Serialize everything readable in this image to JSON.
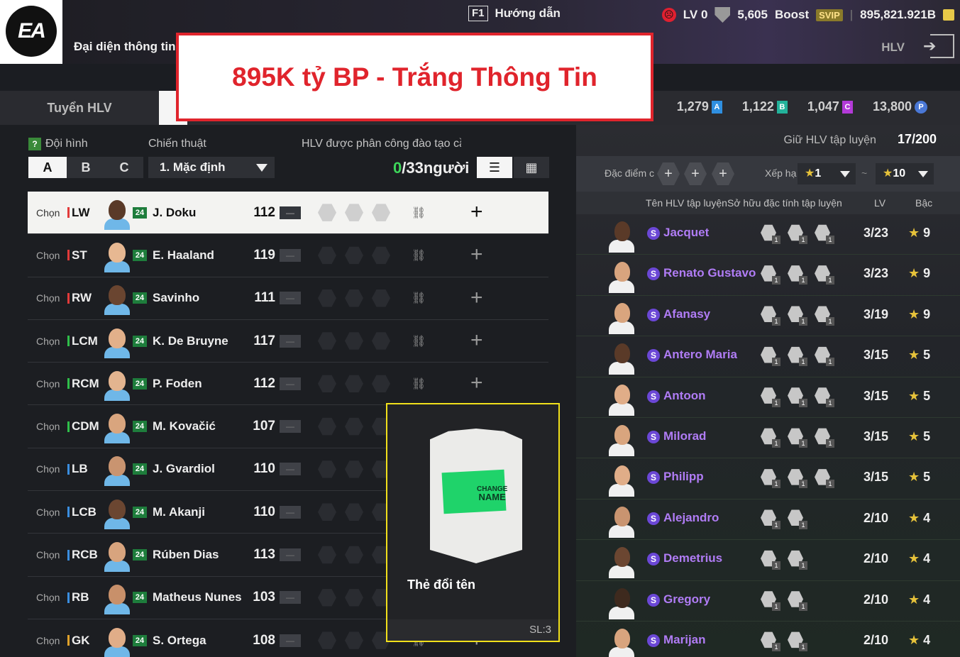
{
  "header": {
    "logo_text": "EA",
    "subtitle": "Đại diện thông tin độ",
    "help_key": "F1",
    "help_label": "Hướng dẫn",
    "lv": "LV 0",
    "rank_points": "5,605",
    "boost_label": "Boost",
    "svip_label": "SVIP",
    "bp": "895,821.921B",
    "hlv_label": "HLV"
  },
  "banner": {
    "text": "895K tỷ BP - Trắng Thông Tin"
  },
  "tabs": {
    "hlv_tab": "Tuyển HLV"
  },
  "currencies": [
    {
      "value": "1,279",
      "badge": "A",
      "color": "#2f8fe0"
    },
    {
      "value": "1,122",
      "badge": "B",
      "color": "#23b39b"
    },
    {
      "value": "1,047",
      "badge": "C",
      "color": "#b33ad8"
    },
    {
      "value": "13,800",
      "badge": "P",
      "color": "#4a78d6"
    }
  ],
  "left": {
    "formation_label": "Đội hình",
    "tactic_label": "Chiến thuật",
    "assign_label": "HLV được phân công đào tạo cầu th",
    "squads": [
      "A",
      "B",
      "C"
    ],
    "tactic_value": "1. Mặc định",
    "count_assigned": "0",
    "count_total": "/33người",
    "choose_label": "Chọn",
    "players": [
      {
        "pos": "LW",
        "pos_color": "#e23a3a",
        "season": "24",
        "name": "J. Doku",
        "ovr": "112",
        "skin": "#5a3a28",
        "kit": "#6fb7e8"
      },
      {
        "pos": "ST",
        "pos_color": "#e23a3a",
        "season": "24",
        "name": "E. Haaland",
        "ovr": "119",
        "skin": "#e7b892",
        "kit": "#6fb7e8"
      },
      {
        "pos": "RW",
        "pos_color": "#e23a3a",
        "season": "24",
        "name": "Savinho",
        "ovr": "111",
        "skin": "#6a4530",
        "kit": "#6fb7e8"
      },
      {
        "pos": "LCM",
        "pos_color": "#2fbf4a",
        "season": "24",
        "name": "K. De Bruyne",
        "ovr": "117",
        "skin": "#e2b08a",
        "kit": "#6fb7e8"
      },
      {
        "pos": "RCM",
        "pos_color": "#2fbf4a",
        "season": "24",
        "name": "P. Foden",
        "ovr": "112",
        "skin": "#e3b48f",
        "kit": "#6fb7e8"
      },
      {
        "pos": "CDM",
        "pos_color": "#2fbf4a",
        "season": "24",
        "name": "M. Kovačić",
        "ovr": "107",
        "skin": "#d9a57e",
        "kit": "#6fb7e8"
      },
      {
        "pos": "LB",
        "pos_color": "#3a8ee0",
        "season": "24",
        "name": "J. Gvardiol",
        "ovr": "110",
        "skin": "#c99470",
        "kit": "#6fb7e8"
      },
      {
        "pos": "LCB",
        "pos_color": "#3a8ee0",
        "season": "24",
        "name": "M. Akanji",
        "ovr": "110",
        "skin": "#6b4631",
        "kit": "#6fb7e8"
      },
      {
        "pos": "RCB",
        "pos_color": "#3a8ee0",
        "season": "24",
        "name": "Rúben Dias",
        "ovr": "113",
        "skin": "#d8a47e",
        "kit": "#6fb7e8"
      },
      {
        "pos": "RB",
        "pos_color": "#3a8ee0",
        "season": "24",
        "name": "Matheus Nunes",
        "ovr": "103",
        "skin": "#c8906a",
        "kit": "#6fb7e8"
      },
      {
        "pos": "GK",
        "pos_color": "#e0a22a",
        "season": "24",
        "name": "S. Ortega",
        "ovr": "108",
        "skin": "#e0ad88",
        "kit": "#6fb7e8"
      }
    ]
  },
  "card_popup": {
    "card_text_line1": "CHANGE",
    "card_text_line2": "NAME",
    "name": "Thẻ đổi tên",
    "quantity": "SL:3"
  },
  "right": {
    "keep_label": "Giữ HLV tập luyện",
    "keep_count": "17/200",
    "trait_filter_label": "Đặc điểm c",
    "rank_filter_label": "Xếp hạ",
    "rank_from": "1",
    "rank_to": "10",
    "col_name": "Tên HLV tập luyện",
    "col_traits": "Sở hữu đặc tính tập luyện",
    "col_lv": "LV",
    "col_rank": "Bậc",
    "coaches": [
      {
        "name": "Jacquet",
        "lv": "3/23",
        "rank": "9",
        "traits": [
          "1",
          "1",
          "1"
        ],
        "skin": "#5a3a28"
      },
      {
        "name": "Renato Gustavo",
        "lv": "3/23",
        "rank": "9",
        "traits": [
          "1",
          "1",
          "1"
        ],
        "skin": "#d8a47e"
      },
      {
        "name": "Afanasy",
        "lv": "3/19",
        "rank": "9",
        "traits": [
          "1",
          "1",
          "1"
        ],
        "skin": "#d9a57e"
      },
      {
        "name": "Antero Maria",
        "lv": "3/15",
        "rank": "5",
        "traits": [
          "1",
          "1",
          "1"
        ],
        "skin": "#5a3a28"
      },
      {
        "name": "Antoon",
        "lv": "3/15",
        "rank": "5",
        "traits": [
          "1",
          "1",
          "1"
        ],
        "skin": "#e0ad88"
      },
      {
        "name": "Milorad",
        "lv": "3/15",
        "rank": "5",
        "traits": [
          "1",
          "1",
          "1"
        ],
        "skin": "#d9a57e"
      },
      {
        "name": "Philipp",
        "lv": "3/15",
        "rank": "5",
        "traits": [
          "1",
          "1",
          "1"
        ],
        "skin": "#e0ad88"
      },
      {
        "name": "Alejandro",
        "lv": "2/10",
        "rank": "4",
        "traits": [
          "1",
          "1"
        ],
        "skin": "#c99470"
      },
      {
        "name": "Demetrius",
        "lv": "2/10",
        "rank": "4",
        "traits": [
          "1",
          "1"
        ],
        "skin": "#6b4631"
      },
      {
        "name": "Gregory",
        "lv": "2/10",
        "rank": "4",
        "traits": [
          "1",
          "1"
        ],
        "skin": "#3e2a1e"
      },
      {
        "name": "Marijan",
        "lv": "2/10",
        "rank": "4",
        "traits": [
          "1",
          "1"
        ],
        "skin": "#d8a47e"
      }
    ]
  }
}
